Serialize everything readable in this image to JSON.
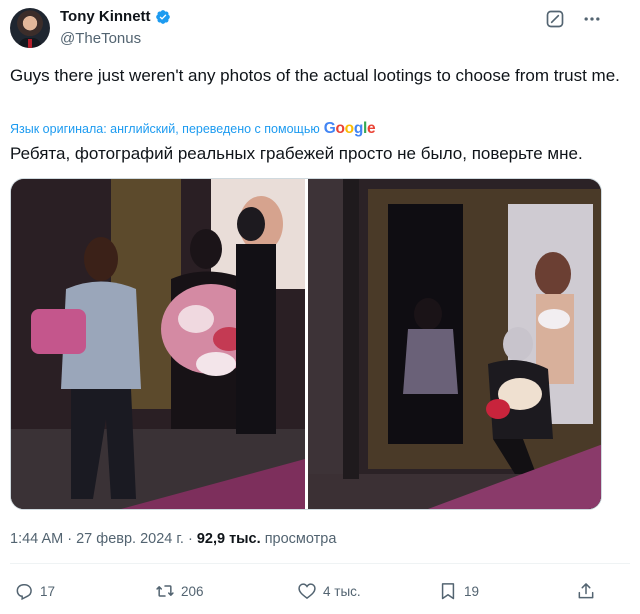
{
  "author": {
    "display_name": "Tony Kinnett",
    "handle": "@TheTonus"
  },
  "tweet": {
    "text": "Guys there just weren't any photos of the actual lootings to choose from trust me.",
    "translation_note": "Язык оригинала: английский, переведено с помощью",
    "translation_provider": "Google",
    "translated_text": "Ребята, фотографий реальных грабежей просто не было, поверьте мне."
  },
  "meta": {
    "time": "1:44 AM",
    "separator": "·",
    "date": "27 февр. 2024 г.",
    "views_count": "92,9 тыс.",
    "views_label": "просмотра"
  },
  "actions": {
    "replies": "17",
    "reposts": "206",
    "likes": "4 тыс.",
    "bookmarks": "19"
  },
  "icons": {
    "verified": "verified-badge-icon",
    "grok": "grok-icon",
    "more": "more-icon",
    "reply": "reply-icon",
    "repost": "repost-icon",
    "like": "heart-icon",
    "bookmark": "bookmark-icon",
    "share": "share-icon"
  },
  "colors": {
    "accent": "#1d9bf0",
    "text_primary": "#0f1419",
    "text_secondary": "#536471",
    "border": "#cfd9de"
  }
}
